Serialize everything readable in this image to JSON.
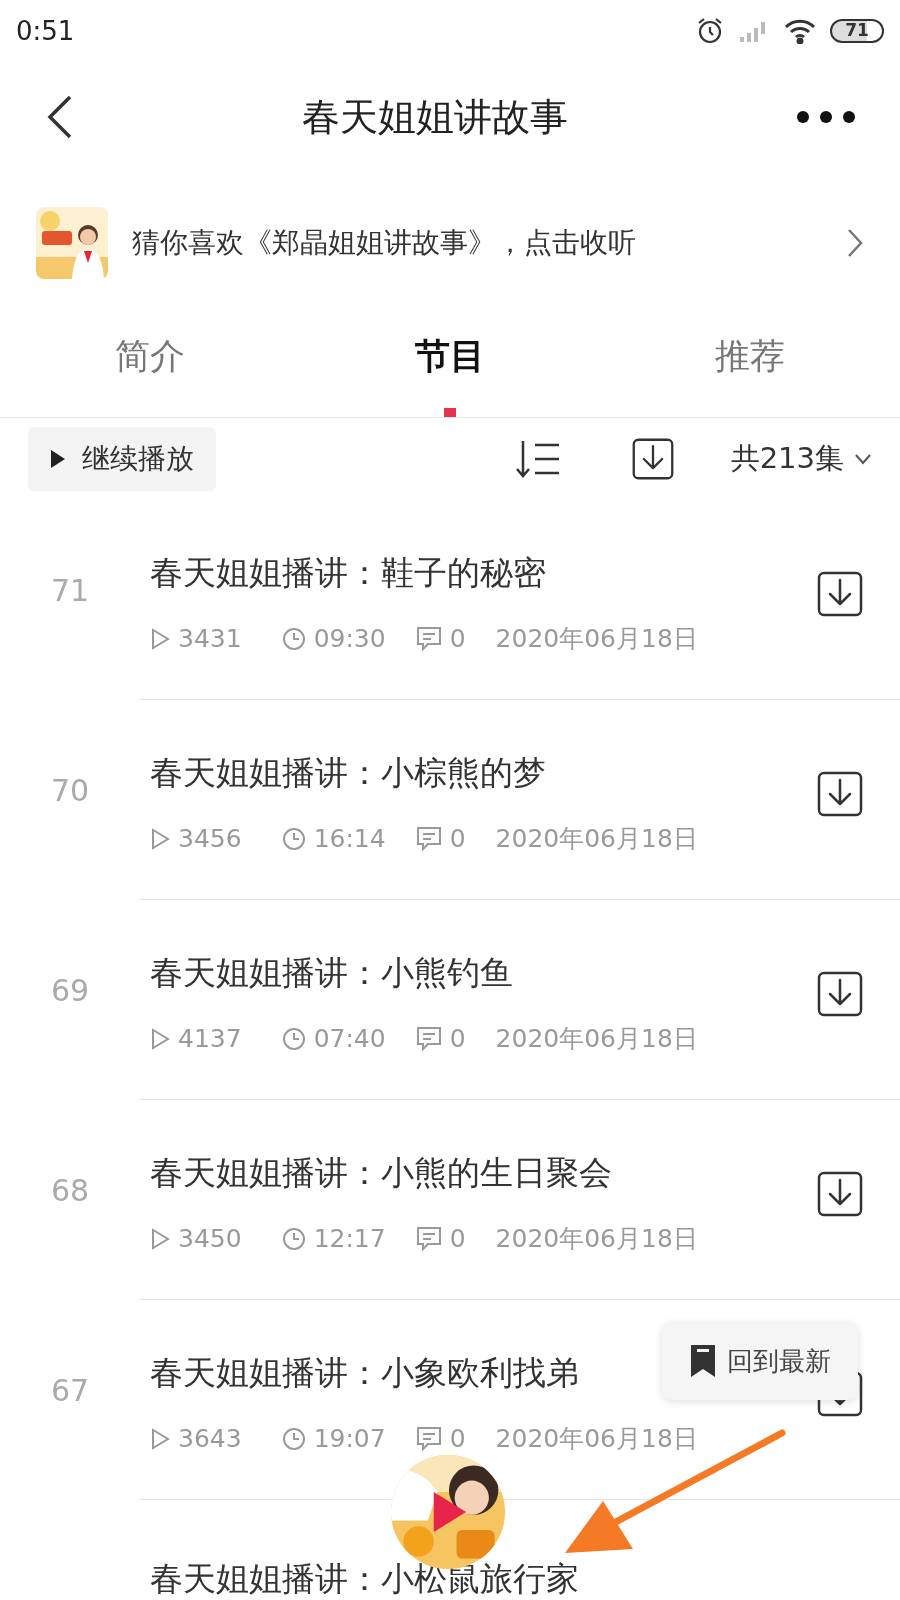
{
  "status_bar": {
    "time": "0:51",
    "battery": "71"
  },
  "header": {
    "title": "春天姐姐讲故事"
  },
  "recommend": {
    "text": "猜你喜欢《郑晶姐姐讲故事》，点击收听"
  },
  "tabs": [
    {
      "label": "简介",
      "selected": false
    },
    {
      "label": "节目",
      "selected": true
    },
    {
      "label": "推荐",
      "selected": false
    }
  ],
  "toolbar": {
    "continue": "继续播放",
    "count": "共213集"
  },
  "episodes": [
    {
      "number": "71",
      "title": "春天姐姐播讲：鞋子的秘密",
      "plays": "3431",
      "duration": "09:30",
      "comments": "0",
      "date": "2020年06月18日"
    },
    {
      "number": "70",
      "title": "春天姐姐播讲：小棕熊的梦",
      "plays": "3456",
      "duration": "16:14",
      "comments": "0",
      "date": "2020年06月18日"
    },
    {
      "number": "69",
      "title": "春天姐姐播讲：小熊钓鱼",
      "plays": "4137",
      "duration": "07:40",
      "comments": "0",
      "date": "2020年06月18日"
    },
    {
      "number": "68",
      "title": "春天姐姐播讲：小熊的生日聚会",
      "plays": "3450",
      "duration": "12:17",
      "comments": "0",
      "date": "2020年06月18日"
    },
    {
      "number": "67",
      "title": "春天姐姐播讲：小象欧利找弟",
      "plays": "3643",
      "duration": "19:07",
      "comments": "0",
      "date": "2020年06月18日"
    },
    {
      "title": "春天姐姐播讲：小松鼠旅行家"
    }
  ],
  "back_to_latest": "回到最新"
}
